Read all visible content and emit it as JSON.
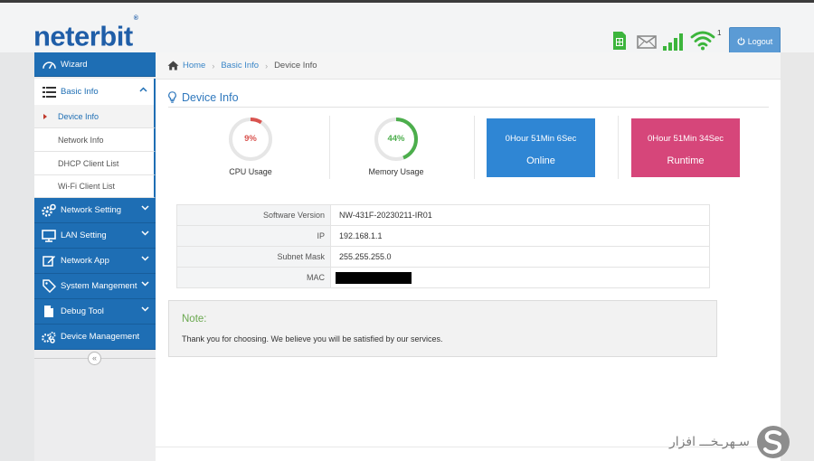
{
  "brand": {
    "logo_text": "neterbit",
    "logo_mark": "®"
  },
  "header": {
    "logout_label": "Logout",
    "signal_superscript": "1",
    "icons": [
      "sim-card-icon",
      "mail-icon",
      "cellular-signal-icon",
      "wifi-icon"
    ]
  },
  "sidebar": {
    "wizard": "Wizard",
    "basic_info": "Basic Info",
    "sub_items": [
      "Device Info",
      "Network Info",
      "DHCP Client List",
      "Wi-Fi Client List"
    ],
    "network_setting": "Network Setting",
    "lan_setting": "LAN Setting",
    "network_app": "Network App",
    "system_management": "System Mangement",
    "debug_tool": "Debug Tool",
    "device_management": "Device Management",
    "collapse_symbol": "«"
  },
  "breadcrumb": {
    "home": "Home",
    "parent": "Basic Info",
    "current": "Device Info",
    "separator": "›"
  },
  "page_title": "Device Info",
  "stats": {
    "cpu": {
      "value": "9%",
      "fraction": 0.09,
      "label": "CPU Usage",
      "color": "#d9534f"
    },
    "memory": {
      "value": "44%",
      "fraction": 0.44,
      "label": "Memory Usage",
      "color": "#4cae4c"
    },
    "online": {
      "time": "0Hour 51Min 6Sec",
      "label": "Online",
      "color": "#2f86d4"
    },
    "runtime": {
      "time": "0Hour 51Min 34Sec",
      "label": "Runtime",
      "color": "#d6467a"
    }
  },
  "device_info": {
    "rows": [
      {
        "key": "Software Version",
        "value": "NW-431F-20230211-IR01"
      },
      {
        "key": "IP",
        "value": "192.168.1.1"
      },
      {
        "key": "Subnet Mask",
        "value": "255.255.255.0"
      },
      {
        "key": "MAC",
        "value": ""
      }
    ]
  },
  "note": {
    "title": "Note:",
    "text": "Thank you for choosing. We believe you will be satisfied by our services."
  },
  "watermark": {
    "text": "سـهرـخـــ افزار"
  }
}
